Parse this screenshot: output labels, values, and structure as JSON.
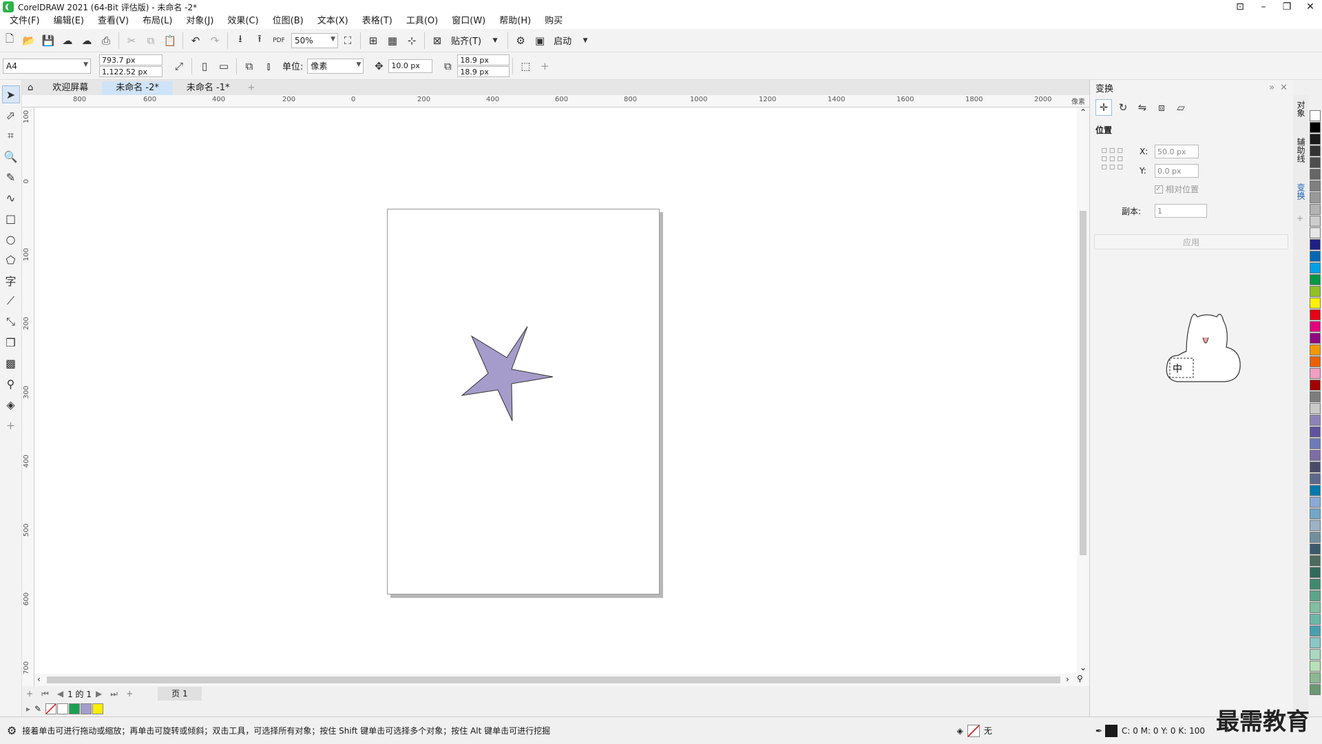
{
  "window": {
    "title": "CorelDRAW 2021 (64-Bit 评估版) - 未命名 -2*"
  },
  "menu": [
    "文件(F)",
    "编辑(E)",
    "查看(V)",
    "布局(L)",
    "对象(J)",
    "效果(C)",
    "位图(B)",
    "文本(X)",
    "表格(T)",
    "工具(O)",
    "窗口(W)",
    "帮助(H)",
    "购买"
  ],
  "standard_toolbar": {
    "zoom": "50%",
    "snap_label": "贴齐(T)",
    "launch_label": "启动",
    "pdf_label": "PDF"
  },
  "property_bar": {
    "page_size": "A4",
    "width": "793.7 px",
    "height": "1,122.52 px",
    "units_label": "单位:",
    "units_value": "像素",
    "nudge": "10.0 px",
    "dup_x": "18.9 px",
    "dup_y": "18.9 px"
  },
  "tabs": {
    "home": "欢迎屏幕",
    "doc2": "未命名 -2*",
    "doc1": "未命名 -1*"
  },
  "ruler_h": [
    "800",
    "600",
    "400",
    "200",
    "0",
    "200",
    "400",
    "600",
    "800",
    "1000",
    "1200",
    "1400",
    "1600",
    "1800",
    "2000"
  ],
  "ruler_v": [
    "100",
    "0",
    "100",
    "200",
    "300",
    "400",
    "500",
    "600",
    "700"
  ],
  "ruler_unit": "像素",
  "star": {
    "fill": "#a59ccb",
    "stroke": "#333333"
  },
  "page_nav": {
    "counter": "1 的 1",
    "page_tab": "页 1"
  },
  "doc_palette": [
    "#ffffff",
    "#1aa050",
    "#a59ccb",
    "#ffee00"
  ],
  "docker": {
    "title": "变换",
    "section": "位置",
    "x_label": "X:",
    "x_value": "50.0 px",
    "y_label": "Y:",
    "y_value": "0.0 px",
    "relative": "相对位置",
    "copies_label": "副本:",
    "copies_value": "1",
    "apply": "应用"
  },
  "side_tabs": [
    "对象",
    "辅助线",
    "变换"
  ],
  "status": {
    "hint": "接着单击可进行拖动或缩放；再单击可旋转或倾斜；双击工具，可选择所有对象；按住 Shift 键单击可选择多个对象；按住 Alt 键单击可进行挖掘",
    "fill_label": "无",
    "cmyk": "C: 0 M: 0 Y: 0 K: 100"
  },
  "watermark": "最需教育",
  "palette": [
    "#ffffff",
    "#000000",
    "#1a1a1a",
    "#333333",
    "#4d4d4d",
    "#666666",
    "#808080",
    "#999999",
    "#b3b3b3",
    "#cccccc",
    "#e6e6e6",
    "#1d2088",
    "#0068b7",
    "#00a0e9",
    "#009944",
    "#8fc31f",
    "#fff100",
    "#e60012",
    "#e4007f",
    "#920783",
    "#f39800",
    "#eb6100",
    "#f19ec2",
    "#a40000",
    "#7d7d7d",
    "#c9caca",
    "#8f82bc",
    "#5f52a0",
    "#6c7bb9",
    "#7e6ca8",
    "#4a4a6a",
    "#5b6a8a",
    "#007ab0",
    "#88abda",
    "#6fa8c8",
    "#9cb2c8",
    "#7090a0",
    "#3c5a6e",
    "#4c6a5e",
    "#2f6b5a",
    "#3e8a6e",
    "#5aa58a",
    "#80c0a0",
    "#6ab8a8",
    "#48a0b0",
    "#88c8c8",
    "#a8d8c0",
    "#b8e0b8",
    "#8ab890",
    "#6a9a70"
  ]
}
